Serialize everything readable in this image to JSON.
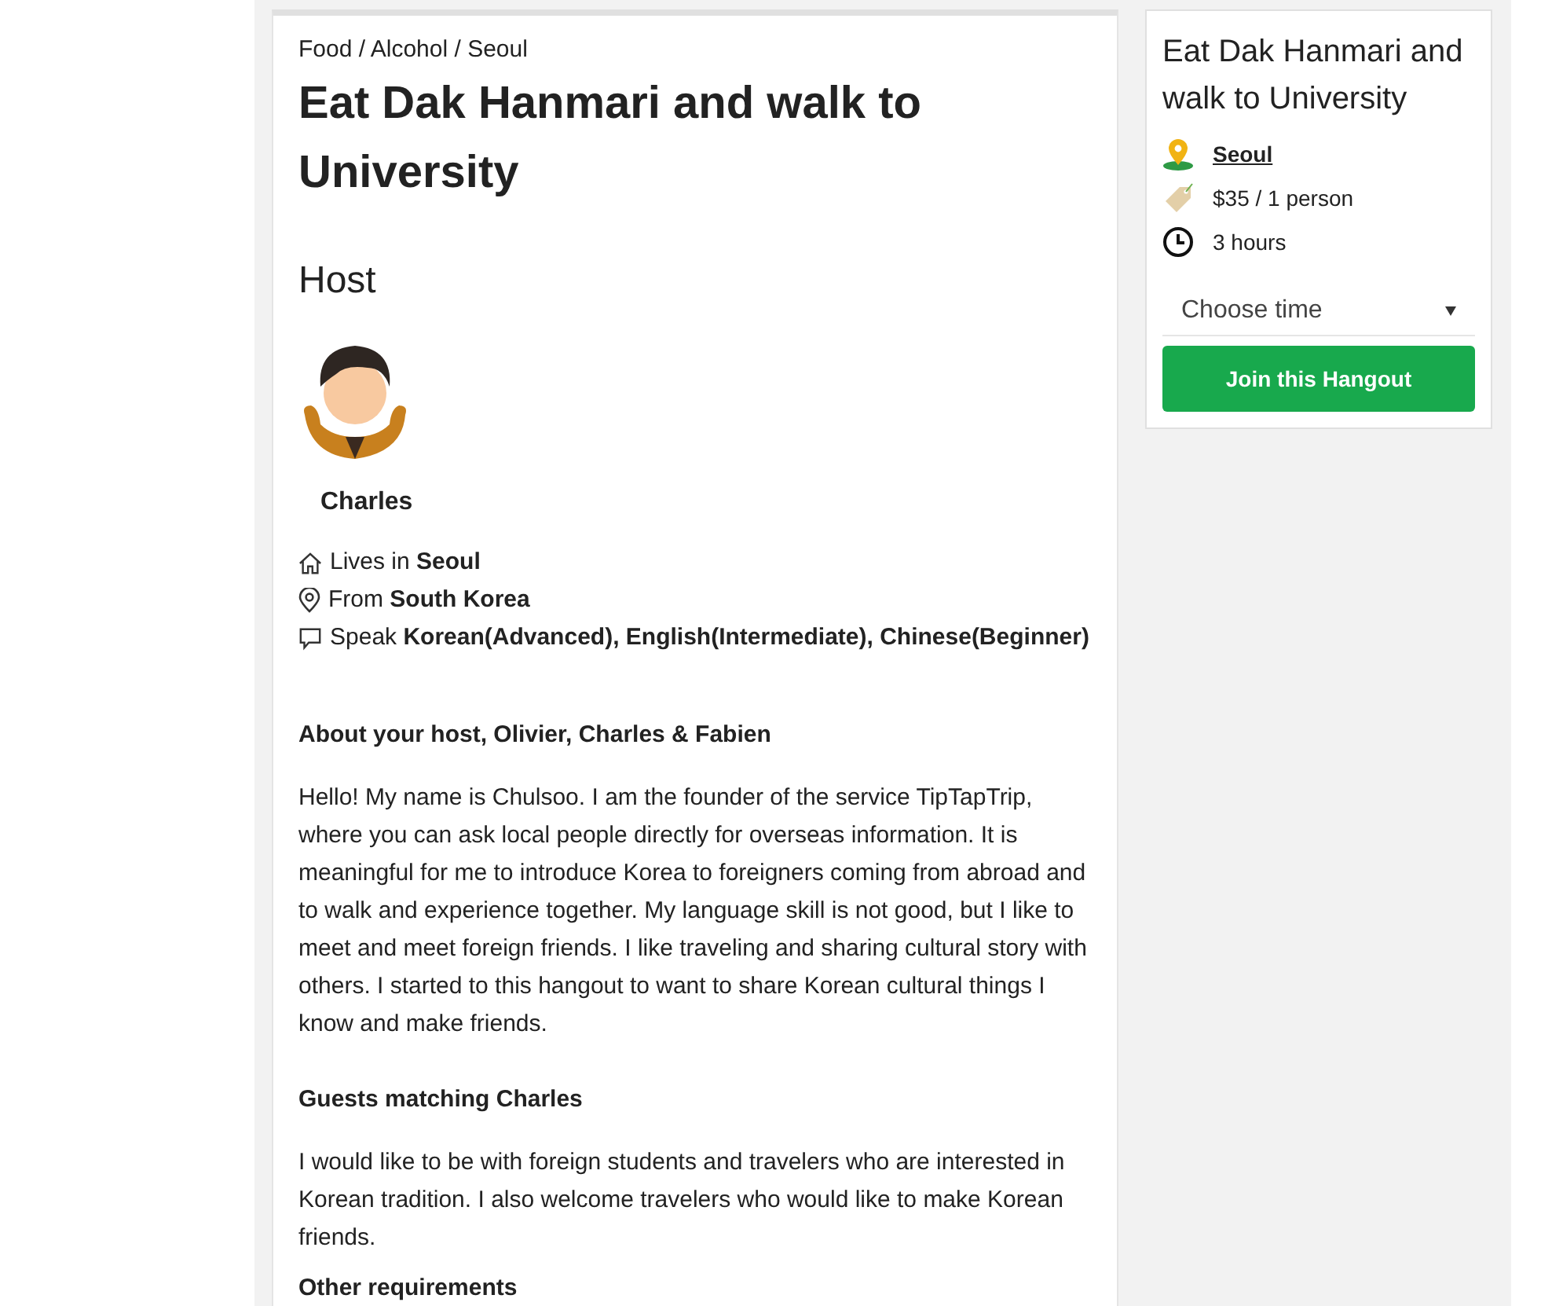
{
  "breadcrumb": "Food / Alcohol / Seoul",
  "title": "Eat Dak Hanmari and walk to University",
  "host": {
    "heading": "Host",
    "name": "Charles",
    "facts": [
      {
        "kind": "home",
        "text": "Lives in **Seoul**"
      },
      {
        "kind": "pin",
        "text": "From **South Korea**"
      },
      {
        "kind": "speech",
        "text": "Speak **Korean(Advanced), English(Intermediate), Chinese(Beginner)**"
      }
    ]
  },
  "sections": [
    {
      "heading": "About your host, Olivier, Charles & Fabien",
      "body": "Hello! My name is Chulsoo. I am the founder of the service TipTapTrip, where you can ask local people directly for overseas information. It is meaningful for me to introduce Korea to foreigners coming from abroad and to walk and experience together. My language skill is not good, but I like to meet and meet foreign friends. I like traveling and sharing cultural story with others. I started to this hangout to want to share Korean cultural things I know and make friends."
    },
    {
      "heading": "Guests matching Charles",
      "body": "I would like to be with foreign students and travelers who are interested in Korean tradition. I also welcome travelers who would like to make Korean friends."
    },
    {
      "heading": "Other requirements"
    }
  ],
  "booking": {
    "title": "Eat Dak Hanmari and walk to University",
    "details": [
      {
        "kind": "location",
        "text": "Seoul"
      },
      {
        "kind": "price",
        "text": "$35 / 1 person"
      },
      {
        "kind": "duration",
        "text": "3 hours"
      }
    ],
    "select": {
      "placeholder": "Choose time"
    },
    "button": "Join this Hangout"
  }
}
